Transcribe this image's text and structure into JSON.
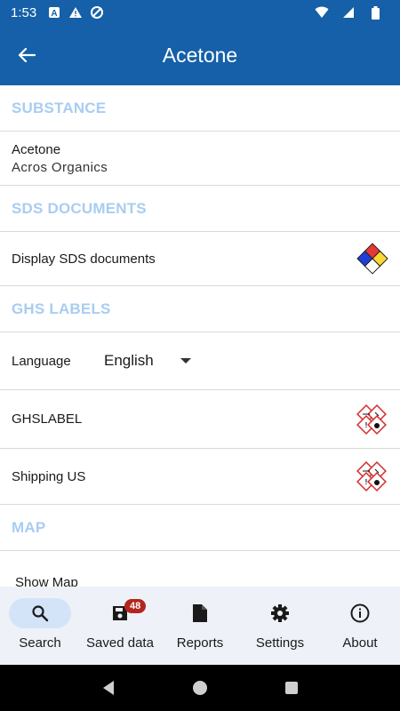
{
  "status_bar": {
    "time": "1:53"
  },
  "app_bar": {
    "title": "Acetone"
  },
  "sections": {
    "substance": {
      "header": "SUBSTANCE",
      "name": "Acetone",
      "vendor": "Acros Organics"
    },
    "sds": {
      "header": "SDS DOCUMENTS",
      "display_label": "Display SDS documents"
    },
    "ghs": {
      "header": "GHS LABELS",
      "language_label": "Language",
      "language_value": "English",
      "ghslabel": "GHSLABEL",
      "shipping": "Shipping US"
    },
    "map": {
      "header": "MAP",
      "show_map": "Show Map"
    }
  },
  "bottom_nav": {
    "search": "Search",
    "saved": "Saved data",
    "saved_badge": "48",
    "reports": "Reports",
    "settings": "Settings",
    "about": "About"
  },
  "colors": {
    "primary": "#1560a8",
    "section_header": "#a8cdf2",
    "nav_bg": "#eef2f8",
    "nav_active": "#d3e3f8",
    "badge": "#b3261e"
  },
  "icons": {
    "back": "arrow-left-icon",
    "sds": "nfpa-diamond-icon",
    "ghs": "ghs-pictogram-icon",
    "search": "search-icon",
    "saved": "save-disk-icon",
    "reports": "document-icon",
    "settings": "gear-icon",
    "about": "info-icon"
  }
}
